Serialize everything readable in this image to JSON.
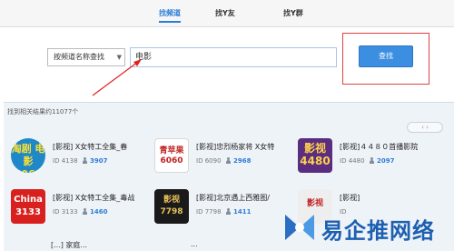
{
  "tabs": [
    {
      "label": "找频道"
    },
    {
      "label": "找Y友"
    },
    {
      "label": "找Y群"
    }
  ],
  "search": {
    "select_value": "按频道名称查找",
    "input_value": "电影",
    "button_label": "查找"
  },
  "results": {
    "count_text": "找到相关结果约11077个",
    "cards": [
      {
        "logo_text": "淘剧 电影 6060",
        "title": "[影视] X女特工全集_春",
        "id_label": "ID",
        "id": "4138",
        "members": "3907"
      },
      {
        "logo_text": "青苹果 6060",
        "title": "[影视]忠烈杨家将 X女特",
        "id_label": "ID",
        "id": "6090",
        "members": "2968"
      },
      {
        "logo_text": "影视 4480",
        "title": "[影视]４４８０首播影院",
        "id_label": "ID",
        "id": "4480",
        "members": "2097"
      },
      {
        "logo_text": "China 3133",
        "title": "[影视] X女特工全集_毒战",
        "id_label": "ID",
        "id": "3133",
        "members": "1460"
      },
      {
        "logo_text": "影视 7798",
        "title": "[影视]北京遇上西雅图/",
        "id_label": "ID",
        "id": "7798",
        "members": "1411"
      },
      {
        "logo_text": "影视",
        "title": "[影视]",
        "id_label": "ID",
        "id": "",
        "members": ""
      }
    ],
    "partial_row": [
      "[...] 家庭...",
      "..."
    ]
  },
  "watermark": {
    "text": "易企推网络"
  },
  "colors": {
    "accent": "#2b7dd6",
    "button": "#3c8ee0",
    "highlight": "#e04040"
  }
}
